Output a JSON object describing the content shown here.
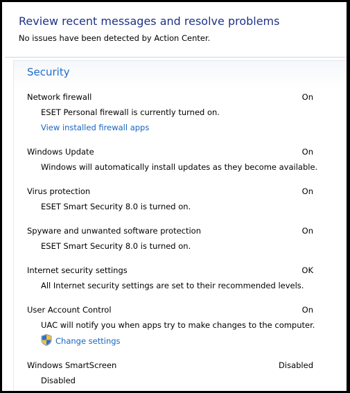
{
  "header": {
    "title": "Review recent messages and resolve problems",
    "subtitle": "No issues have been detected by Action Center."
  },
  "security": {
    "title": "Security",
    "items": [
      {
        "name": "Network firewall",
        "status": "On",
        "description": "ESET Personal firewall is currently turned on.",
        "link": "View installed firewall apps"
      },
      {
        "name": "Windows Update",
        "status": "On",
        "description": "Windows will automatically install updates as they become available."
      },
      {
        "name": "Virus protection",
        "status": "On",
        "description": "ESET Smart Security 8.0 is turned on."
      },
      {
        "name": "Spyware and unwanted software protection",
        "status": "On",
        "description": "ESET Smart Security 8.0 is turned on."
      },
      {
        "name": "Internet security settings",
        "status": "OK",
        "description": "All Internet security settings are set to their recommended levels."
      },
      {
        "name": "User Account Control",
        "status": "On",
        "description": "UAC will notify you when apps try to make changes to the computer.",
        "link": "Change settings",
        "link_icon": "uac-shield-icon"
      },
      {
        "name": "Windows SmartScreen",
        "status": "Disabled",
        "description": "Disabled"
      }
    ]
  },
  "colors": {
    "header_title": "#1e3287",
    "section_title": "#1e6ec8",
    "link": "#1665c1"
  }
}
